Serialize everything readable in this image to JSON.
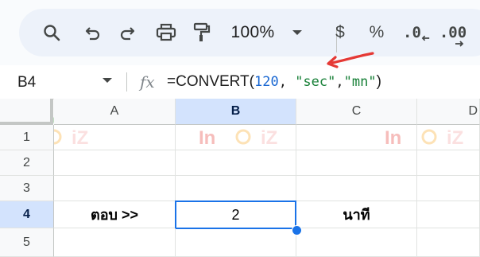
{
  "toolbar": {
    "zoom": "100%",
    "currency_label": "$",
    "percent_label": "%",
    "decrease_decimals_label": ".0",
    "increase_decimals_label": ".00"
  },
  "formula_bar": {
    "cell_ref": "B4",
    "fx_label": "fx",
    "formula_parts": {
      "func": "=CONVERT(",
      "num": "120",
      "sep1": ", ",
      "str1": "\"sec\"",
      "sep2": ",",
      "str2": "\"mn\"",
      "close": ")"
    }
  },
  "grid": {
    "columns": [
      "A",
      "B",
      "C",
      "D"
    ],
    "rows": [
      "1",
      "2",
      "3",
      "4",
      "5"
    ],
    "cells": {
      "A4": "ตอบ >>",
      "B4": "2",
      "C4": "นาที"
    },
    "selected_cell": "B4"
  },
  "watermark": {
    "letters_left": "In",
    "letters_right": "iZ"
  },
  "colors": {
    "accent": "#1a73e8",
    "header_active": "#d3e3fd",
    "arrow": "#e53935",
    "formula_number": "#1967d2",
    "formula_string": "#188038"
  }
}
